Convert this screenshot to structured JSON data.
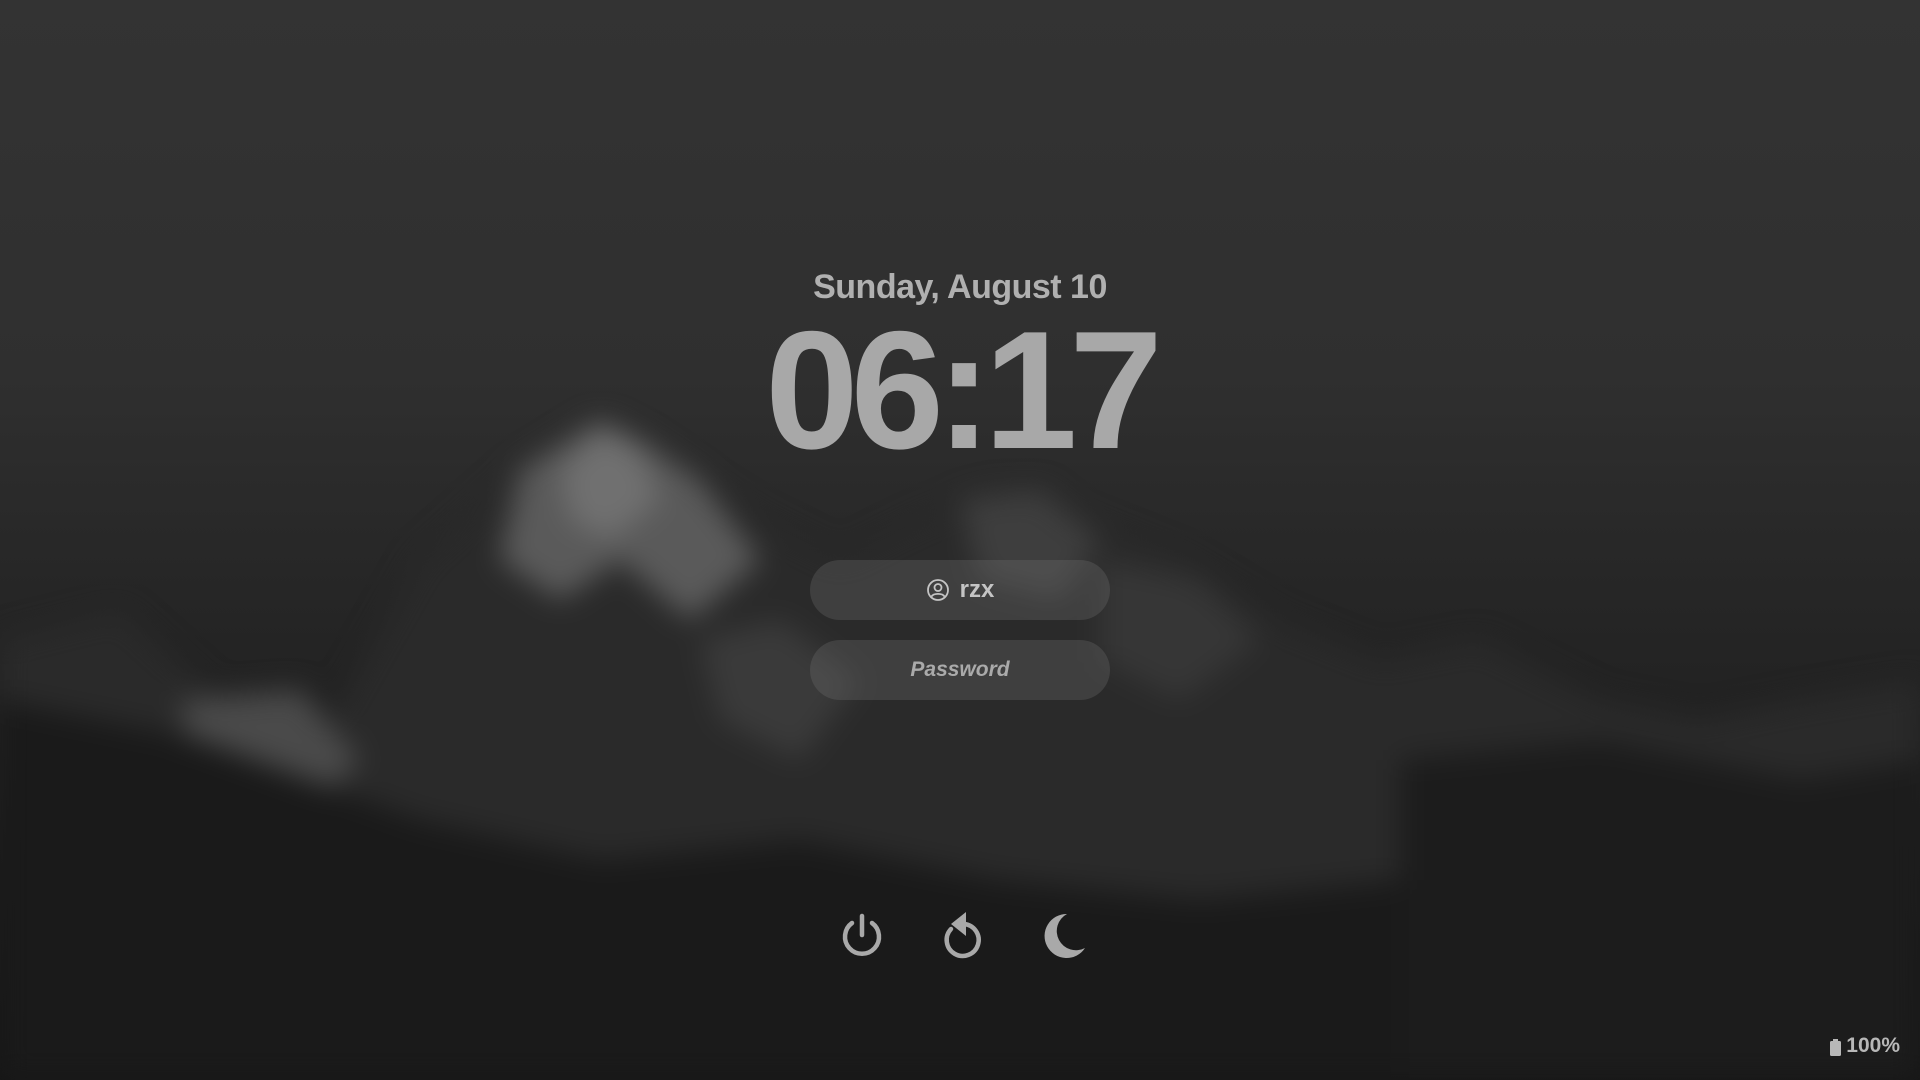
{
  "lockscreen": {
    "date": "Sunday, August 10",
    "time": "06:17"
  },
  "login": {
    "username": "rzx",
    "user_icon": "user-circle-icon",
    "password_placeholder": "Password",
    "password_value": ""
  },
  "power_actions": [
    {
      "name": "shutdown",
      "icon": "power-icon"
    },
    {
      "name": "restart",
      "icon": "restart-icon"
    },
    {
      "name": "sleep",
      "icon": "moon-icon"
    }
  ],
  "status": {
    "battery_level": "100%",
    "battery_icon": "battery-icon"
  },
  "colors": {
    "text": "#a9a9a9",
    "pill_background": "rgba(120,120,120,0.28)",
    "wallpaper_sky": "#333333",
    "wallpaper_ground": "#161616"
  }
}
